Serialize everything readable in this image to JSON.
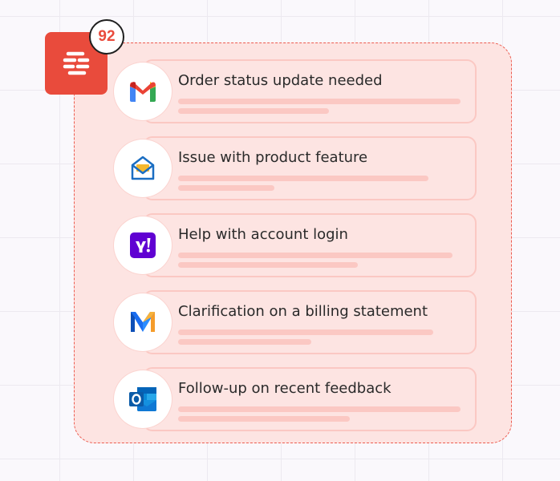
{
  "brand": {
    "logo_icon": "helpdesk-logo-icon",
    "accent_color": "#e94b3c"
  },
  "notification": {
    "count": "92"
  },
  "messages": [
    {
      "provider_icon": "gmail-icon",
      "subject": "Order status update needed"
    },
    {
      "provider_icon": "email-client-icon",
      "subject": "Issue with product feature"
    },
    {
      "provider_icon": "yahoo-mail-icon",
      "subject": "Help with account login"
    },
    {
      "provider_icon": "mailbox-app-icon",
      "subject": "Clarification on a billing statement"
    },
    {
      "provider_icon": "outlook-icon",
      "subject": "Follow-up on recent feedback"
    }
  ]
}
